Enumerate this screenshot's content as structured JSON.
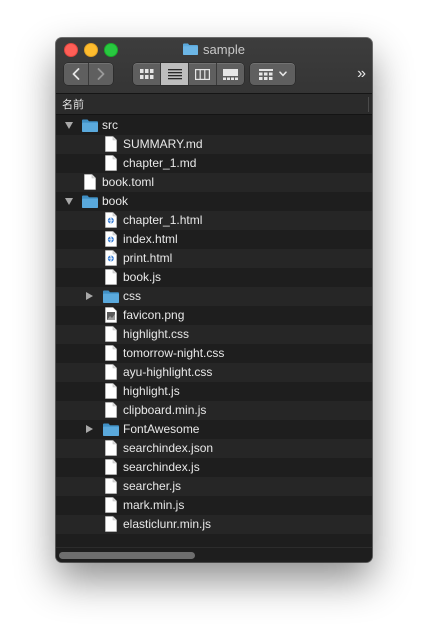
{
  "window": {
    "title": "sample"
  },
  "toolbar": {
    "back": "back-button",
    "forward": "forward-button",
    "overflow_label": "»"
  },
  "columns": {
    "name_header": "名前"
  },
  "rows": [
    {
      "label": "src",
      "kind": "folder",
      "depth": 0,
      "expanded": true
    },
    {
      "label": "SUMMARY.md",
      "kind": "file",
      "depth": 1
    },
    {
      "label": "chapter_1.md",
      "kind": "file",
      "depth": 1
    },
    {
      "label": "book.toml",
      "kind": "file",
      "depth": 0
    },
    {
      "label": "book",
      "kind": "folder",
      "depth": 0,
      "expanded": true
    },
    {
      "label": "chapter_1.html",
      "kind": "html",
      "depth": 1
    },
    {
      "label": "index.html",
      "kind": "html",
      "depth": 1
    },
    {
      "label": "print.html",
      "kind": "html",
      "depth": 1
    },
    {
      "label": "book.js",
      "kind": "file",
      "depth": 1
    },
    {
      "label": "css",
      "kind": "folder",
      "depth": 1,
      "expanded": false
    },
    {
      "label": "favicon.png",
      "kind": "image",
      "depth": 1
    },
    {
      "label": "highlight.css",
      "kind": "file",
      "depth": 1
    },
    {
      "label": "tomorrow-night.css",
      "kind": "file",
      "depth": 1
    },
    {
      "label": "ayu-highlight.css",
      "kind": "file",
      "depth": 1
    },
    {
      "label": "highlight.js",
      "kind": "file",
      "depth": 1
    },
    {
      "label": "clipboard.min.js",
      "kind": "file",
      "depth": 1
    },
    {
      "label": "FontAwesome",
      "kind": "folder",
      "depth": 1,
      "expanded": false
    },
    {
      "label": "searchindex.json",
      "kind": "file",
      "depth": 1
    },
    {
      "label": "searchindex.js",
      "kind": "file",
      "depth": 1
    },
    {
      "label": "searcher.js",
      "kind": "file",
      "depth": 1
    },
    {
      "label": "mark.min.js",
      "kind": "file",
      "depth": 1
    },
    {
      "label": "elasticlunr.min.js",
      "kind": "file",
      "depth": 1
    },
    {
      "label": "",
      "kind": "empty",
      "depth": 0
    },
    {
      "label": "",
      "kind": "empty",
      "depth": 0
    }
  ],
  "colors": {
    "folder": "#5aa9dc",
    "folder_dark": "#3f8fc4",
    "file": "#ffffff"
  },
  "scroll": {
    "horizontal_fraction": 0.44
  }
}
